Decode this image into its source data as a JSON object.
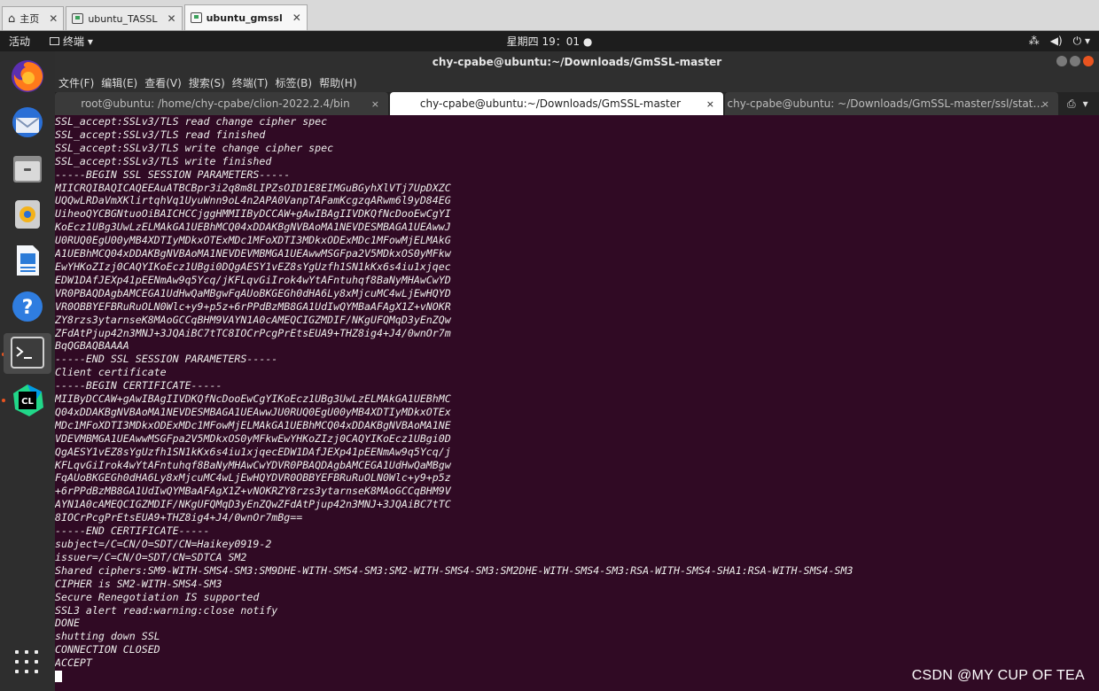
{
  "vm_tabs": [
    {
      "label": "主页",
      "icon": "home-icon",
      "active": false
    },
    {
      "label": "ubuntu_TASSL",
      "icon": "vm-icon",
      "active": false
    },
    {
      "label": "ubuntu_gmssl",
      "icon": "vm-icon",
      "active": true
    }
  ],
  "topbar": {
    "activities": "活动",
    "app_menu": "终端 ▾",
    "clock": "星期四 19：01 ●",
    "tray_icons": [
      "network-icon",
      "volume-icon",
      "power-icon"
    ]
  },
  "window": {
    "title": "chy-cpabe@ubuntu:~/Downloads/GmSSL-master"
  },
  "menubar": [
    "文件(F)",
    "编辑(E)",
    "查看(V)",
    "搜索(S)",
    "终端(T)",
    "标签(B)",
    "帮助(H)"
  ],
  "term_tabs": [
    {
      "label": "root@ubuntu: /home/chy-cpabe/clion-2022.2.4/bin",
      "active": false
    },
    {
      "label": "chy-cpabe@ubuntu:~/Downloads/GmSSL-master",
      "active": true
    },
    {
      "label": "chy-cpabe@ubuntu: ~/Downloads/GmSSL-master/ssl/stat…",
      "active": false
    }
  ],
  "terminal_lines": [
    "SSL_accept:SSLv3/TLS read change cipher spec",
    "SSL_accept:SSLv3/TLS read finished",
    "SSL_accept:SSLv3/TLS write change cipher spec",
    "SSL_accept:SSLv3/TLS write finished",
    "-----BEGIN SSL SESSION PARAMETERS-----",
    "MIICRQIBAQICAQEEAuATBCBpr3i2q8m8LIPZsOID1E8EIMGuBGyhXlVTj7UpDXZC",
    "UQQwLRDaVmXKlirtqhVq1UyuWnn9oL4n2APA0VanpTAFamKcgzqARwm6l9yD84EG",
    "UiheoQYCBGNtuoOiBAICHCCjggHMMIIByDCCAW+gAwIBAgIIVDKQfNcDooEwCgYI",
    "KoEcz1UBg3UwLzELMAkGA1UEBhMCQ04xDDAKBgNVBAoMA1NEVDESMBAGA1UEAwwJ",
    "U0RUQ0EgU00yMB4XDTIyMDkxOTExMDc1MFoXDTI3MDkxODExMDc1MFowMjELMAkG",
    "A1UEBhMCQ04xDDAKBgNVBAoMA1NEVDEVMBMGA1UEAwwMSGFpa2V5MDkxOS0yMFkw",
    "EwYHKoZIzj0CAQYIKoEcz1UBgi0DQgAESY1vEZ8sYgUzfh1SN1kKx6s4iu1xjqec",
    "EDW1DAfJEXp41pEENmAw9q5Ycq/jKFLqvGiIrok4wYtAFntuhqf8BaNyMHAwCwYD",
    "VR0PBAQDAgbAMCEGA1UdHwQaMBgwFqAUoBKGEGh0dHA6Ly8xMjcuMC4wLjEwHQYD",
    "VR0OBBYEFBRuRuOLN0Wlc+y9+p5z+6rPPdBzMB8GA1UdIwQYMBaAFAgX1Z+vNOKR",
    "ZY8rzs3ytarnseK8MAoGCCqBHM9VAYN1A0cAMEQCIGZMDIF/NKgUFQMqD3yEnZQw",
    "ZFdAtPjup42n3MNJ+3JQAiBC7tTC8IOCrPcgPrEtsEUA9+THZ8ig4+J4/0wnOr7m",
    "BqQGBAQBAAAA",
    "-----END SSL SESSION PARAMETERS-----",
    "Client certificate",
    "-----BEGIN CERTIFICATE-----",
    "MIIByDCCAW+gAwIBAgIIVDKQfNcDooEwCgYIKoEcz1UBg3UwLzELMAkGA1UEBhMC",
    "Q04xDDAKBgNVBAoMA1NEVDESMBAGA1UEAwwJU0RUQ0EgU00yMB4XDTIyMDkxOTEx",
    "MDc1MFoXDTI3MDkxODExMDc1MFowMjELMAkGA1UEBhMCQ04xDDAKBgNVBAoMA1NE",
    "VDEVMBMGA1UEAwwMSGFpa2V5MDkxOS0yMFkwEwYHKoZIzj0CAQYIKoEcz1UBgi0D",
    "QgAESY1vEZ8sYgUzfh1SN1kKx6s4iu1xjqecEDW1DAfJEXp41pEENmAw9q5Ycq/j",
    "KFLqvGiIrok4wYtAFntuhqf8BaNyMHAwCwYDVR0PBAQDAgbAMCEGA1UdHwQaMBgw",
    "FqAUoBKGEGh0dHA6Ly8xMjcuMC4wLjEwHQYDVR0OBBYEFBRuRuOLN0Wlc+y9+p5z",
    "+6rPPdBzMB8GA1UdIwQYMBaAFAgX1Z+vNOKRZY8rzs3ytarnseK8MAoGCCqBHM9V",
    "AYN1A0cAMEQCIGZMDIF/NKgUFQMqD3yEnZQwZFdAtPjup42n3MNJ+3JQAiBC7tTC",
    "8IOCrPcgPrEtsEUA9+THZ8ig4+J4/0wnOr7mBg==",
    "-----END CERTIFICATE-----",
    "subject=/C=CN/O=SDT/CN=Haikey0919-2",
    "issuer=/C=CN/O=SDT/CN=SDTCA SM2",
    "Shared ciphers:SM9-WITH-SMS4-SM3:SM9DHE-WITH-SMS4-SM3:SM2-WITH-SMS4-SM3:SM2DHE-WITH-SMS4-SM3:RSA-WITH-SMS4-SHA1:RSA-WITH-SMS4-SM3",
    "CIPHER is SM2-WITH-SMS4-SM3",
    "Secure Renegotiation IS supported",
    "SSL3 alert read:warning:close notify",
    "DONE",
    "shutting down SSL",
    "CONNECTION CLOSED",
    "ACCEPT"
  ],
  "watermark": "CSDN @MY CUP OF TEA",
  "colors": {
    "terminal_bg": "#300a24",
    "accent": "#e95420"
  }
}
